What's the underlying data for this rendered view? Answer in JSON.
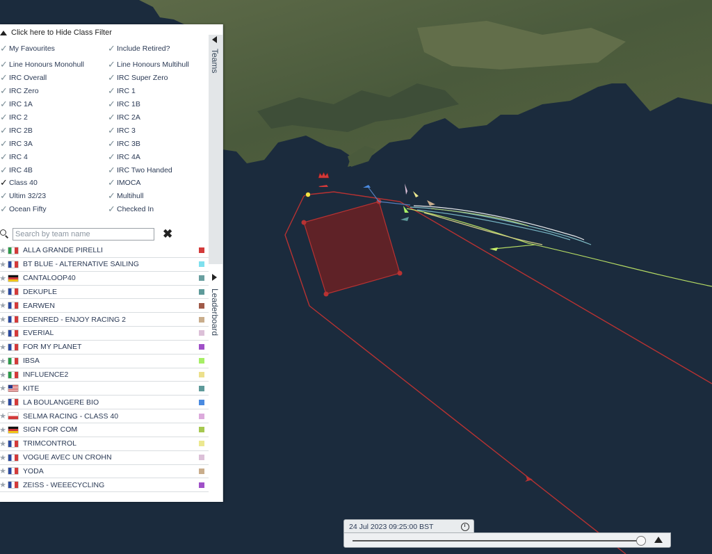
{
  "filter": {
    "toggle_label": "Click here to Hide Class Filter",
    "classes": [
      {
        "label": "My Favourites",
        "checked": false
      },
      {
        "label": "Include Retired?",
        "checked": false
      },
      {
        "label": "Line Honours Monohull",
        "checked": false
      },
      {
        "label": "Line Honours Multihull",
        "checked": false
      },
      {
        "label": "IRC Overall",
        "checked": false
      },
      {
        "label": "IRC Super Zero",
        "checked": false
      },
      {
        "label": "IRC Zero",
        "checked": false
      },
      {
        "label": "IRC 1",
        "checked": false
      },
      {
        "label": "IRC 1A",
        "checked": false
      },
      {
        "label": "IRC 1B",
        "checked": false
      },
      {
        "label": "IRC 2",
        "checked": false
      },
      {
        "label": "IRC 2A",
        "checked": false
      },
      {
        "label": "IRC 2B",
        "checked": false
      },
      {
        "label": "IRC 3",
        "checked": false
      },
      {
        "label": "IRC 3A",
        "checked": false
      },
      {
        "label": "IRC 3B",
        "checked": false
      },
      {
        "label": "IRC 4",
        "checked": false
      },
      {
        "label": "IRC 4A",
        "checked": false
      },
      {
        "label": "IRC 4B",
        "checked": false
      },
      {
        "label": "IRC Two Handed",
        "checked": false
      },
      {
        "label": "Class 40",
        "checked": true
      },
      {
        "label": "IMOCA",
        "checked": false
      },
      {
        "label": "Ultim 32/23",
        "checked": false
      },
      {
        "label": "Multihull",
        "checked": false
      },
      {
        "label": "Ocean Fifty",
        "checked": false
      },
      {
        "label": "Checked In",
        "checked": false
      }
    ]
  },
  "search": {
    "placeholder": "Search by team name"
  },
  "tabs": {
    "teams": "Teams",
    "leaderboard": "Leaderboard"
  },
  "teams": [
    {
      "name": "ALLA GRANDE PIRELLI",
      "flag": "it",
      "color": "#d33a3a"
    },
    {
      "name": "BT BLUE - ALTERNATIVE SAILING",
      "flag": "fr",
      "color": "#7fe0ee"
    },
    {
      "name": "CANTALOOP40",
      "flag": "de",
      "color": "#6a9fa0"
    },
    {
      "name": "DEKUPLE",
      "flag": "fr",
      "color": "#5e9a9a"
    },
    {
      "name": "EARWEN",
      "flag": "fr",
      "color": "#a05a48"
    },
    {
      "name": "EDENRED - ENJOY RACING 2",
      "flag": "fr",
      "color": "#c9ad8c"
    },
    {
      "name": "EVERIAL",
      "flag": "fr",
      "color": "#dcc0d8"
    },
    {
      "name": "FOR MY PLANET",
      "flag": "fr",
      "color": "#a050c8"
    },
    {
      "name": "IBSA",
      "flag": "it",
      "color": "#a6ee66"
    },
    {
      "name": "INFLUENCE2",
      "flag": "it",
      "color": "#ece08c"
    },
    {
      "name": "KITE",
      "flag": "us",
      "color": "#5e9a9a"
    },
    {
      "name": "LA BOULANGERE BIO",
      "flag": "fr",
      "color": "#4a8ae0"
    },
    {
      "name": "SELMA RACING - CLASS 40",
      "flag": "pl",
      "color": "#dcaadc"
    },
    {
      "name": "SIGN FOR COM",
      "flag": "de",
      "color": "#a6c850"
    },
    {
      "name": "TRIMCONTROL",
      "flag": "fr",
      "color": "#ece890"
    },
    {
      "name": "VOGUE AVEC UN CROHN",
      "flag": "fr",
      "color": "#dcc0d8"
    },
    {
      "name": "YODA",
      "flag": "fr",
      "color": "#c9ad8c"
    },
    {
      "name": "ZEISS - WEEECYCLING",
      "flag": "fr",
      "color": "#a050c8"
    }
  ],
  "timeline": {
    "datetime": "24 Jul 2023 09:25:00 BST",
    "position": 0.99
  },
  "colors": {
    "course_line": "#b83232",
    "exclusion_zone": "#7a1e1e",
    "sea": "#1a2a3c",
    "land": "#4f5a3e"
  }
}
